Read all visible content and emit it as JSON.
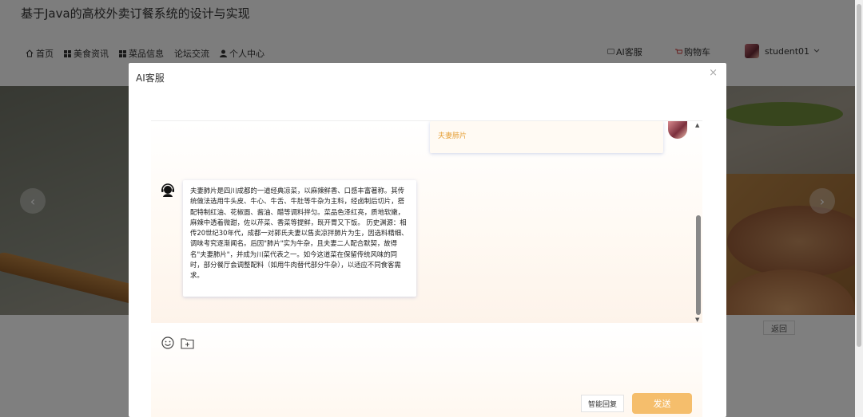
{
  "site": {
    "title": "基于Java的高校外卖订餐系统的设计与实现"
  },
  "nav": {
    "items": [
      {
        "label": "首页",
        "icon": "home-icon"
      },
      {
        "label": "美食资讯",
        "icon": "grid-icon"
      },
      {
        "label": "菜品信息",
        "icon": "grid-icon"
      },
      {
        "label": "论坛交流",
        "icon": ""
      },
      {
        "label": "个人中心",
        "icon": "user-icon"
      }
    ],
    "ai_service": "AI客服",
    "cart": "购物车",
    "username": "student01"
  },
  "page": {
    "return_label": "返回"
  },
  "dialog": {
    "title": "AI客服",
    "close": "×",
    "user_message": "夫妻肺片",
    "bot_message": "夫妻肺片是四川成都的一道经典凉菜，以麻辣鲜香、口感丰富著称。其传统做法选用牛头皮、牛心、牛舌、牛肚等牛杂为主料，经卤制后切片，搭配特制红油、花椒面、酱油、醋等调料拌匀。菜品色泽红亮，质地软嫩，麻辣中透着微甜，佐以芹菜、香菜等提鲜，既开胃又下饭。 历史渊源：相传20世纪30年代，成都一对郭氏夫妻以售卖凉拌肺片为生，因选料精细、调味考究逐渐闻名。后因\"肺片\"实为牛杂，且夫妻二人配合默契，故得名\"夫妻肺片\"，并成为川菜代表之一。如今这道菜在保留传统风味的同时，部分餐厅会调整配料（如用牛肉替代部分牛杂），以适应不同食客需求。",
    "smart_reply": "智能回复",
    "send": "发送"
  },
  "colors": {
    "accent": "#f5be6c",
    "user_text": "#e6a23c"
  }
}
